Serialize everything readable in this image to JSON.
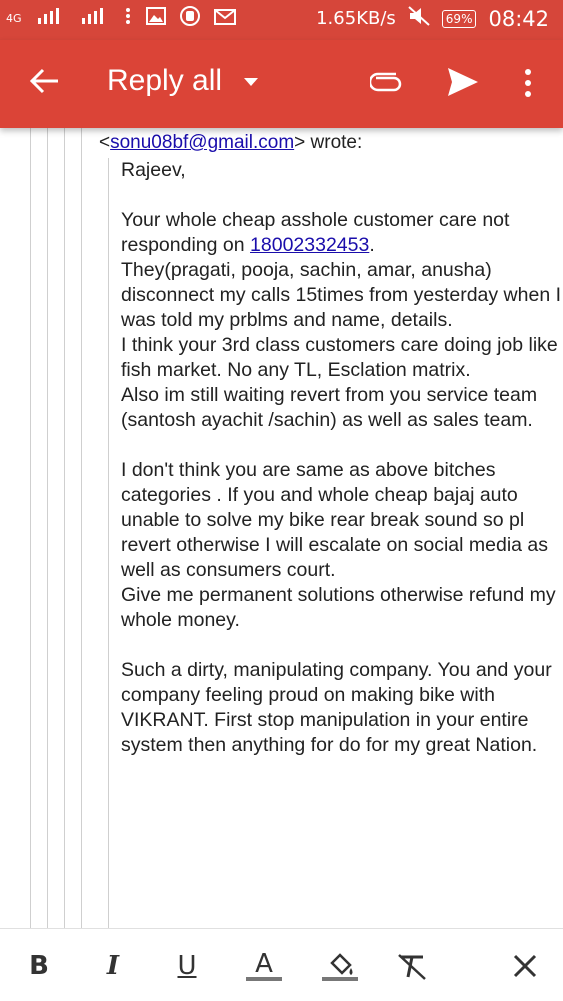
{
  "status_bar": {
    "network_4g": "4G",
    "network_speed": "1.65KB/s",
    "battery": "69%",
    "time": "08:42"
  },
  "app_bar": {
    "title": "Reply all"
  },
  "email": {
    "from_prefix": "<",
    "from_email": "sonu08bf@gmail.com",
    "from_suffix": "> wrote:",
    "greeting": "Rajeev,",
    "p1_before": "Your whole cheap asshole customer care not responding on ",
    "p1_phone": "18002332453",
    "p1_after": ".",
    "p1_line2": "They(pragati, pooja, sachin, amar, anusha) disconnect my calls 15times from yesterday when I was told my prblms and name, details.",
    "p1_line3": "I think your 3rd class customers care doing job like fish market. No any TL, Esclation matrix.",
    "p1_line4": "Also im still waiting revert from you service team (santosh ayachit /sachin) as well as sales team.",
    "p2": "I don't think you are same as above bitches categories .  If you and whole cheap bajaj auto unable to solve my bike rear break sound so pl revert otherwise I will escalate on social media as well as consumers court.",
    "p2_line2": "Give me permanent solutions otherwise refund my whole money.",
    "p3": "Such a dirty, manipulating company. You and your company feeling proud on making bike with VIKRANT. First stop manipulation in your entire system then anything for do for my great Nation."
  },
  "format_toolbar": {
    "bold": "B",
    "italic": "I",
    "underline": "U",
    "text_color": "A"
  },
  "colors": {
    "status_bar": "#d6463a",
    "app_bar": "#db4437",
    "link": "#1a0dab"
  }
}
